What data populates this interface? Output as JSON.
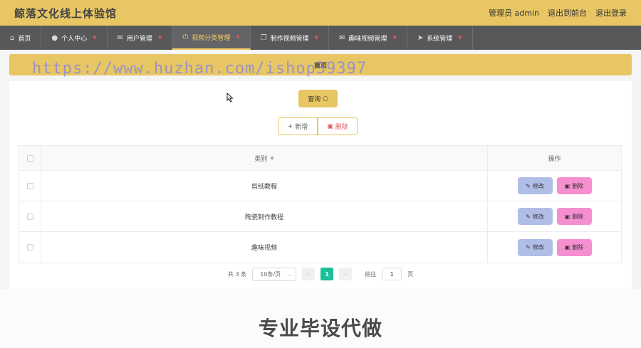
{
  "app": {
    "title": "鲸落文化线上体验馆"
  },
  "header": {
    "links": [
      "管理员 admin",
      "退出到前台",
      "退出登录"
    ]
  },
  "nav": [
    {
      "label": "首页",
      "icon": "home-icon",
      "caret": false,
      "active": false
    },
    {
      "label": "个人中心",
      "icon": "user-icon",
      "caret": true,
      "active": false
    },
    {
      "label": "用户管理",
      "icon": "mail-icon",
      "caret": true,
      "active": false
    },
    {
      "label": "视频分类管理",
      "icon": "power-icon",
      "caret": true,
      "active": true
    },
    {
      "label": "制作视频管理",
      "icon": "copy-icon",
      "caret": true,
      "active": false
    },
    {
      "label": "趣味视频管理",
      "icon": "mail-icon",
      "caret": true,
      "active": false
    },
    {
      "label": "系统管理",
      "icon": "send-icon",
      "caret": true,
      "active": false
    }
  ],
  "breadcrumb": {
    "text": "首页"
  },
  "watermark": "https://www.huzhan.com/ishop39397",
  "toolbar": {
    "query_label": "查询",
    "add_label": "新增",
    "delete_label": "删除"
  },
  "table": {
    "columns": {
      "category": "类别",
      "actions": "操作"
    },
    "rows": [
      {
        "category": "剪纸教程"
      },
      {
        "category": "陶瓷制作教程"
      },
      {
        "category": "趣味视频"
      }
    ],
    "edit_label": "修改",
    "remove_label": "删除"
  },
  "pagination": {
    "total_text": "共 3 条",
    "page_size": "10条/页",
    "current_page": "1",
    "jump_prefix": "前往",
    "jump_value": "1",
    "jump_suffix": "页"
  },
  "footer": {
    "text": "专业毕设代做"
  },
  "colors": {
    "accent": "#e8c663",
    "nav_bg": "#58585a",
    "active_page": "#1bc09a",
    "edit_btn": "#b0bde7",
    "remove_btn": "#f58fcf"
  }
}
